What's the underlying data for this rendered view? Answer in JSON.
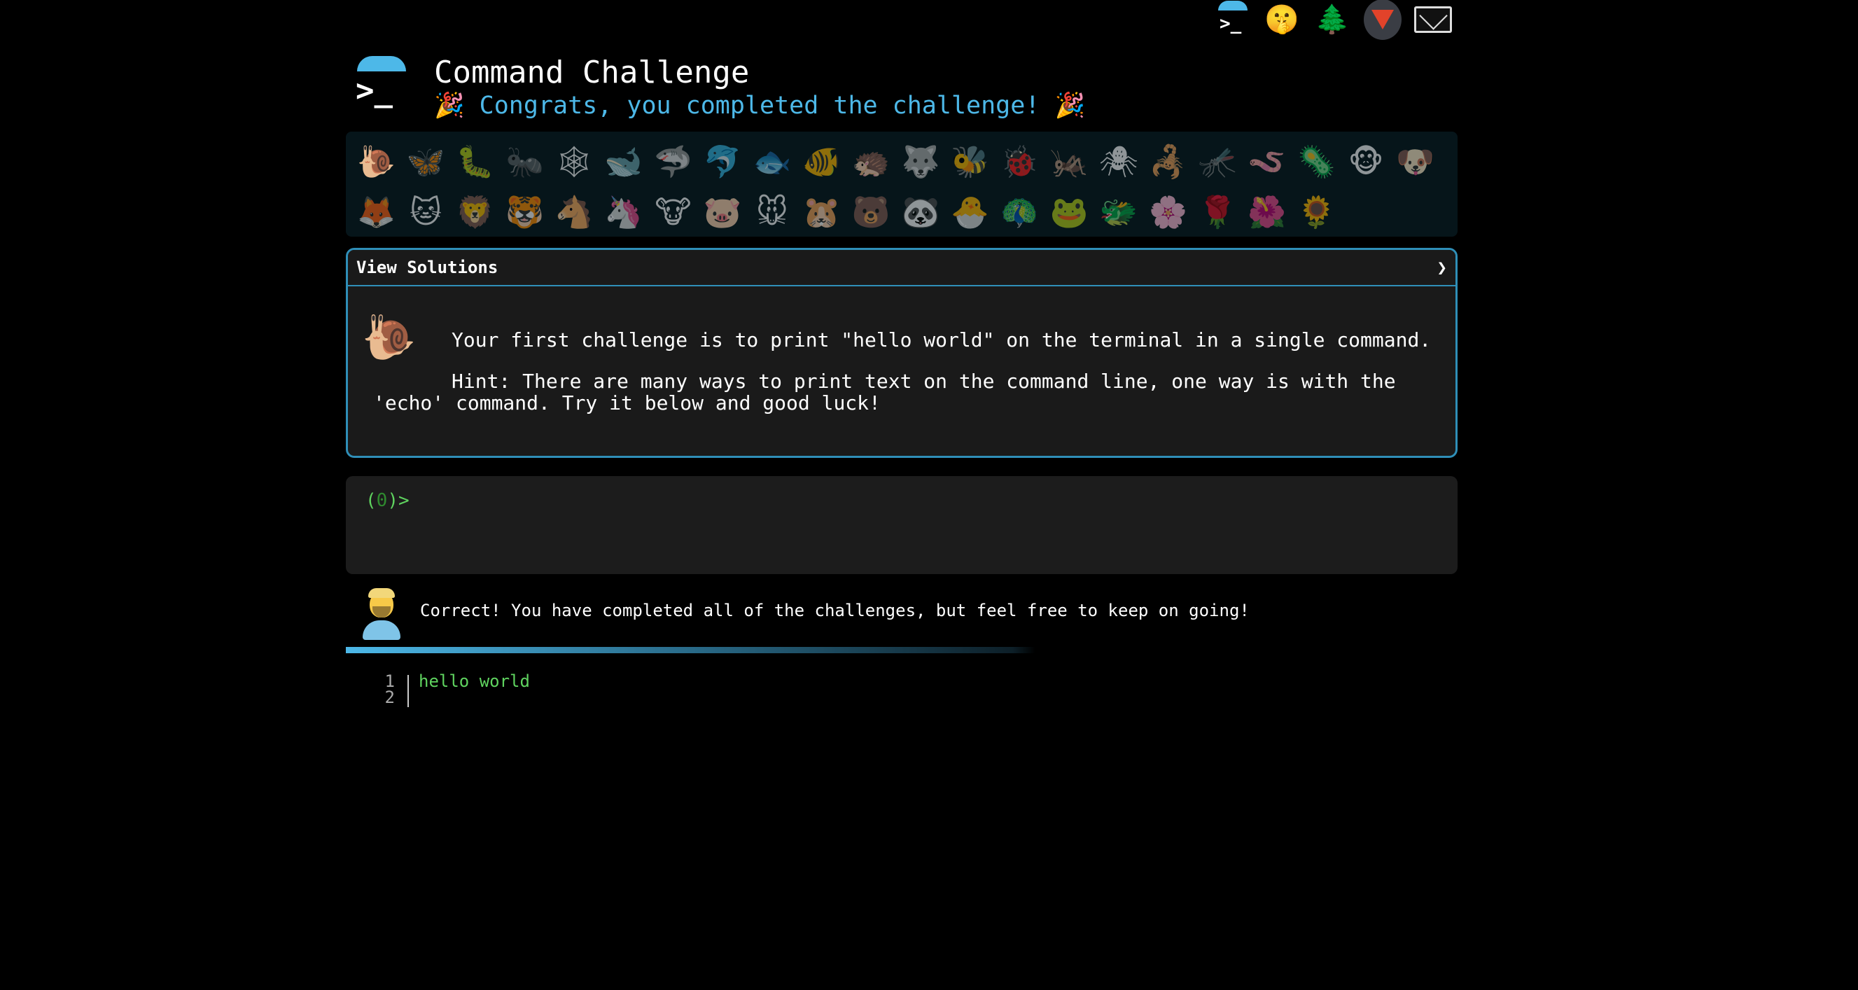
{
  "top_icons": [
    {
      "name": "command-challenge-icon"
    },
    {
      "name": "shushing-face-icon",
      "glyph": "🤫"
    },
    {
      "name": "tree-icon",
      "glyph": "🌲"
    },
    {
      "name": "gitlab-icon"
    },
    {
      "name": "mail-icon"
    }
  ],
  "header": {
    "logo_prompt": ">_",
    "title": "Command Challenge",
    "subtitle": "🎉 Congrats, you completed the challenge! 🎉"
  },
  "emoji_rows": [
    [
      "🐌",
      "🦋",
      "🐛",
      "🐜",
      "🕸",
      "🐋",
      "🦈",
      "🐬",
      "🐟",
      "🐠",
      "🦔",
      "🐺",
      "🐝",
      "🐞",
      "🦗",
      "🕷",
      "🦂",
      "🦟",
      "🪱",
      "🦠",
      "🐵",
      "🐶"
    ],
    [
      "🦊",
      "🐱",
      "🦁",
      "🐯",
      "🐴",
      "🦄",
      "🐮",
      "🐷",
      "🐭",
      "🐹",
      "🐻",
      "🐼",
      "🐣",
      "🦚",
      "🐸",
      "🐲",
      "🌸",
      "🌹",
      "🌺",
      "🌻"
    ]
  ],
  "challenge": {
    "solutions_label": "View Solutions",
    "solutions_chevron": "❯",
    "animal": "🐌",
    "text": "Your first challenge is to print \"hello world\" on the terminal in a single command.",
    "hint": "Hint: There are many ways to print text on the command line, one way is with the 'echo' command. Try it below and good luck!"
  },
  "terminal": {
    "prompt_open": "(",
    "prompt_status": "0",
    "prompt_close": ")>"
  },
  "result": {
    "message": "Correct! You have completed all of the challenges, but feel free to keep on going!"
  },
  "progress": {
    "fraction": 1.0
  },
  "output": {
    "line_numbers": [
      "1",
      "2"
    ],
    "lines": [
      "hello world",
      ""
    ]
  },
  "colors": {
    "accent": "#4db8e8",
    "prompt_green": "#5fd35f",
    "border": "#2f8fb8"
  }
}
